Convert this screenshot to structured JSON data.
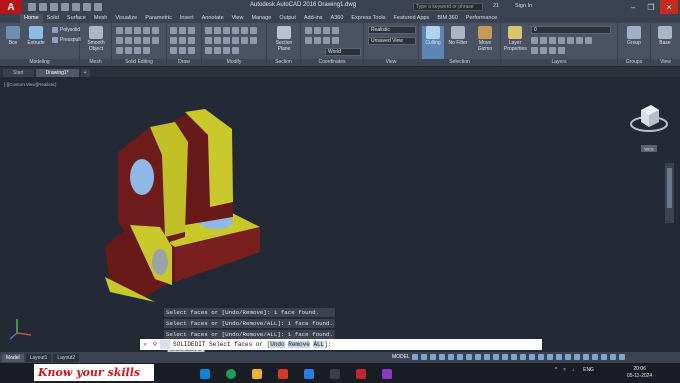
{
  "app": {
    "title": "Autodesk AutoCAD 2016   Drawing1.dwg",
    "search_placeholder": "Type a keyword or phrase",
    "user_count": "21",
    "signin": "Sign In"
  },
  "ribbon_tabs": [
    "Home",
    "Solid",
    "Surface",
    "Mesh",
    "Visualize",
    "Parametric",
    "Insert",
    "Annotate",
    "View",
    "Manage",
    "Output",
    "Add-ins",
    "A360",
    "Express Tools",
    "Featured Apps",
    "BIM 360",
    "Performance"
  ],
  "ribbon": {
    "modeling": {
      "title": "Modeling",
      "box": "Box",
      "extrude": "Extrude",
      "polysolid": "Polysolid",
      "presspull": "Presspull",
      "smooth": "Smooth Object"
    },
    "mesh": {
      "title": "Mesh"
    },
    "solid_editing": {
      "title": "Solid Editing"
    },
    "draw": {
      "title": "Draw"
    },
    "modify": {
      "title": "Modify"
    },
    "section": {
      "title": "Section",
      "plane": "Section Plane"
    },
    "coordinates": {
      "title": "Coordinates",
      "world": "World"
    },
    "view": {
      "title": "View",
      "visual_style": "Realistic",
      "named_view": "Unsaved View"
    },
    "selection": {
      "title": "Selection",
      "culling": "Culling",
      "no_filter": "No Filter",
      "gizmo": "Move Gizmo"
    },
    "layers": {
      "title": "Layers",
      "layer_props": "Layer Properties",
      "layer_value": "0"
    },
    "groups": {
      "title": "Groups",
      "group": "Group"
    },
    "view2": {
      "title": "View",
      "base": "Base"
    }
  },
  "file_tabs": [
    "Start",
    "Drawing1*",
    "+"
  ],
  "viewport": {
    "label": "[-][Custom View][Realistic]",
    "viewcube_label": "WCS",
    "tooltip": "Select faces or"
  },
  "command_history": [
    "Select faces or [Undo/Remove]: 1 face found.",
    "Select faces or [Undo/Remove/ALL]: 1 face found.",
    "Select faces or [Undo/Remove/ALL]: 1 face found."
  ],
  "command_line": {
    "prefix": "SOLIDEDIT Select faces or [",
    "opt1": "Undo",
    "opt2": "Remove",
    "opt3": "ALL",
    "suffix": "]:"
  },
  "layout_tabs": [
    "Model",
    "Layout1",
    "Layout2"
  ],
  "status": {
    "model": "MODEL"
  },
  "banner": "Know your skills",
  "tray": {
    "lang": "ENG"
  },
  "clock": {
    "time": "20:06",
    "date": "05-11-2024"
  }
}
